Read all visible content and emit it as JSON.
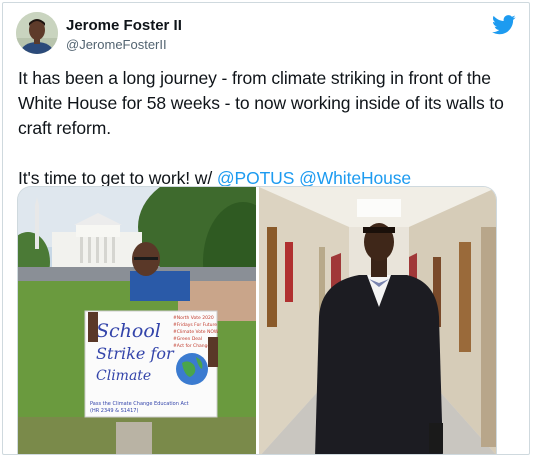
{
  "tweet": {
    "author": {
      "display_name": "Jerome Foster II",
      "handle": "@JeromeFosterII"
    },
    "text_line1": "It has been a long journey - from climate striking in front of the White House for 58 weeks - to now working inside of its walls to craft reform.",
    "text_line2_prefix": "It's time to get to work! w/ ",
    "mentions": [
      "@POTUS",
      "@WhiteHouse"
    ]
  },
  "icons": {
    "platform": "twitter-bird-icon"
  },
  "colors": {
    "link": "#1d9bf0",
    "text": "#0f1419",
    "secondary_text": "#536471",
    "border": "#cfd9de"
  },
  "media": {
    "left_photo": {
      "sign_line1": "School",
      "sign_line2": "Strike for",
      "sign_line3": "Climate",
      "sign_list": [
        "#North Vote 2020",
        "#Fridays For Future",
        "#Climate Vote NOW",
        "#Green Deal",
        "#Act for Change"
      ],
      "sign_footer": "Pass the Climate Change Education Act",
      "sign_footer2": "(HR 2349 & S1417)"
    }
  }
}
